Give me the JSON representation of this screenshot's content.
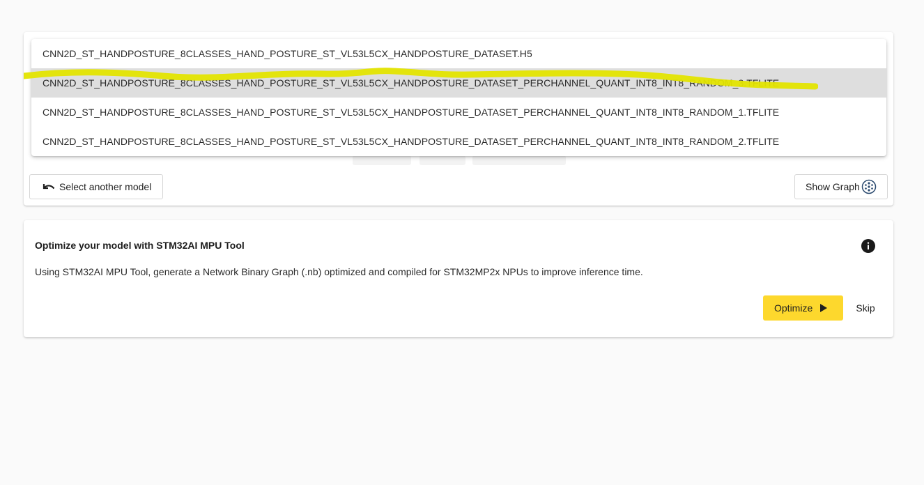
{
  "model_selector": {
    "options": [
      {
        "label": "CNN2D_ST_HANDPOSTURE_8CLASSES_HAND_POSTURE_ST_VL53L5CX_HANDPOSTURE_DATASET.H5",
        "selected": false
      },
      {
        "label": "CNN2D_ST_HANDPOSTURE_8CLASSES_HAND_POSTURE_ST_VL53L5CX_HANDPOSTURE_DATASET_PERCHANNEL_QUANT_INT8_INT8_RANDOM_3.TFLITE",
        "selected": true
      },
      {
        "label": "CNN2D_ST_HANDPOSTURE_8CLASSES_HAND_POSTURE_ST_VL53L5CX_HANDPOSTURE_DATASET_PERCHANNEL_QUANT_INT8_INT8_RANDOM_1.TFLITE",
        "selected": false
      },
      {
        "label": "CNN2D_ST_HANDPOSTURE_8CLASSES_HAND_POSTURE_ST_VL53L5CX_HANDPOSTURE_DATASET_PERCHANNEL_QUANT_INT8_INT8_RANDOM_2.TFLITE",
        "selected": false
      }
    ],
    "select_another_label": "Select another model",
    "select_another_icon": "undo-arrow-icon",
    "show_graph_label": "Show Graph",
    "show_graph_icon": "graph-network-icon"
  },
  "optimize_panel": {
    "title": "Optimize your model with STM32AI MPU Tool",
    "description": "Using STM32AI MPU Tool, generate a Network Binary Graph (.nb) optimized and compiled for STM32MP2x NPUs to improve inference time.",
    "info_icon": "info-icon",
    "optimize_label": "Optimize",
    "optimize_icon": "play-icon",
    "skip_label": "Skip"
  },
  "colors": {
    "page_background": "#fafafa",
    "accent_yellow": "#fdd82d",
    "highlighter_yellow": "#e3e400",
    "selected_row": "#dedede"
  }
}
